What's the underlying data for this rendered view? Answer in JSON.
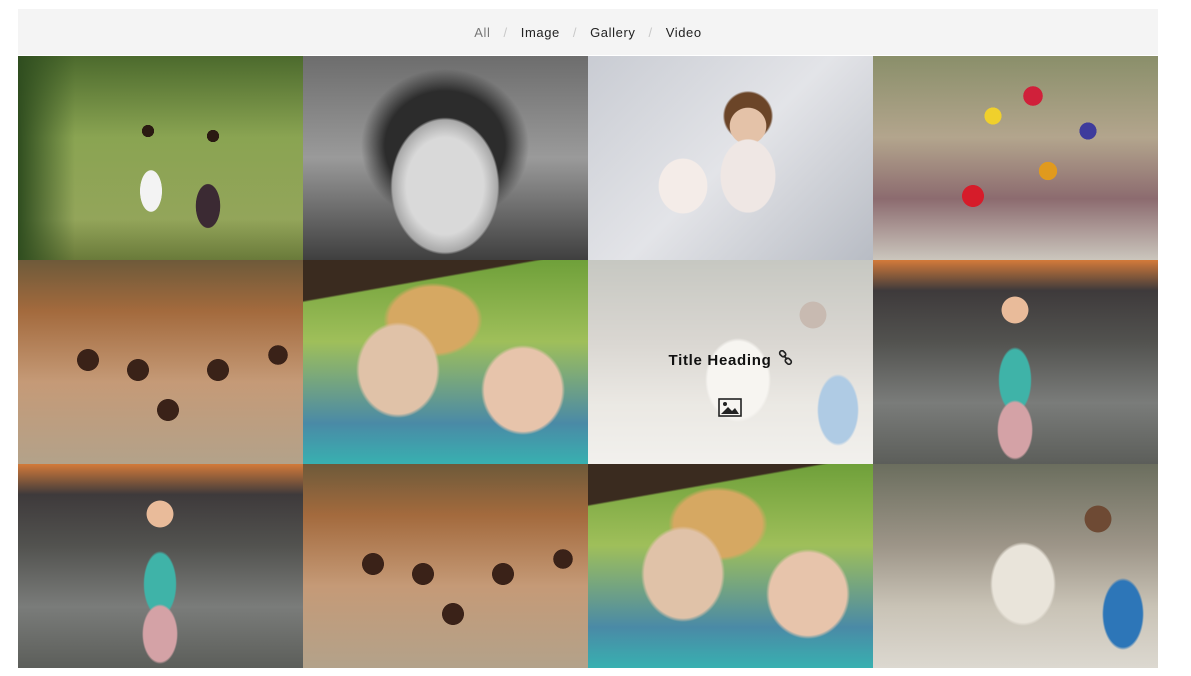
{
  "filters": {
    "all": "All",
    "image": "Image",
    "gallery": "Gallery",
    "video": "Video",
    "separator": "/"
  },
  "hover_overlay": {
    "title": "Title Heading",
    "link_icon": "link-icon",
    "media_icon": "image-icon"
  },
  "gallery": {
    "items": [
      {
        "photo": "two-girls-walking-in-park"
      },
      {
        "photo": "black-and-white-girl-with-flower-crown"
      },
      {
        "photo": "baby-and-girl-lying-on-blanket"
      },
      {
        "photo": "children-in-colorful-scarves-sitting"
      },
      {
        "photo": "group-of-school-children-smiling"
      },
      {
        "photo": "two-girls-drinking-water"
      },
      {
        "photo": "boy-and-girl-in-scarves",
        "hovered": true
      },
      {
        "photo": "girl-with-bag-at-sunset"
      },
      {
        "photo": "girl-with-bag-at-sunset"
      },
      {
        "photo": "group-of-school-children-smiling"
      },
      {
        "photo": "two-girls-drinking-water"
      },
      {
        "photo": "boy-and-girl-in-scarves"
      }
    ]
  }
}
